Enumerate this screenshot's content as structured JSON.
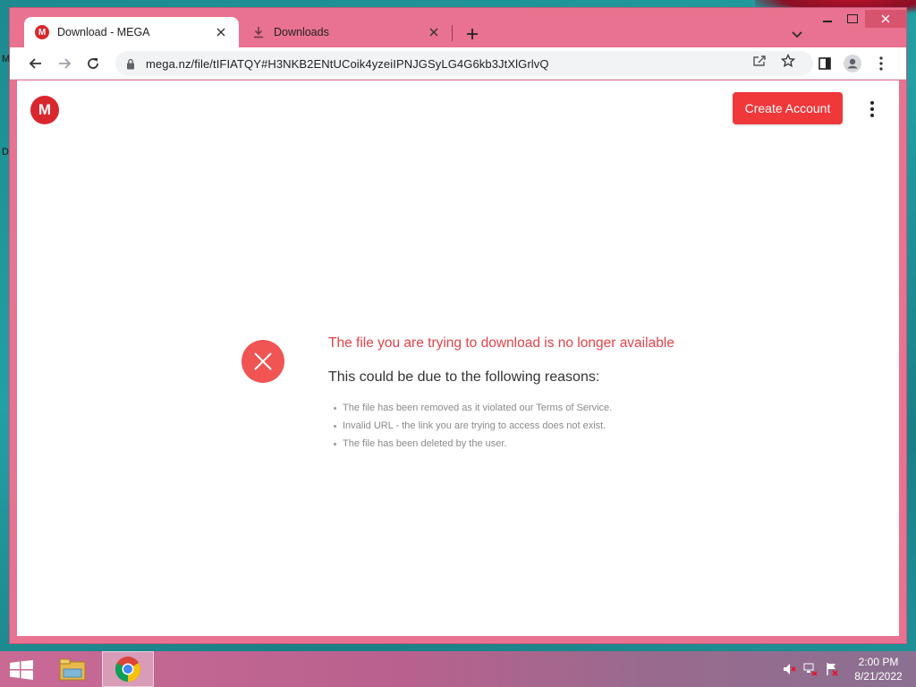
{
  "desktop": {
    "labels": [
      "M",
      "D"
    ],
    "taskbar": {
      "apps": [
        "file-explorer",
        "chrome"
      ],
      "clock_time": "2:00 PM",
      "clock_date": "8/21/2022"
    }
  },
  "browser": {
    "tabs": [
      {
        "label": "Download - MEGA",
        "favicon": "M",
        "active": true
      },
      {
        "label": "Downloads",
        "active": false
      }
    ],
    "address_bar": {
      "url": "mega.nz/file/tIFIATQY#H3NKB2ENtUCoik4yzeiIPNJGSyLG4G6kb3JtXlGrlvQ"
    }
  },
  "page": {
    "logo_letter": "M",
    "create_account_label": "Create Account",
    "error_title": "The file you are trying to download is no longer available",
    "error_subtitle": "This could be due to the following reasons:",
    "reasons": [
      "The file has been removed as it violated our Terms of Service.",
      "Invalid URL - the link you are trying to access does not exist.",
      "The file has been deleted by the user."
    ]
  },
  "colors": {
    "window_frame": "#e8728f",
    "mega_red": "#d9272e",
    "button_red": "#f0373a",
    "error_red": "#e2434a"
  }
}
